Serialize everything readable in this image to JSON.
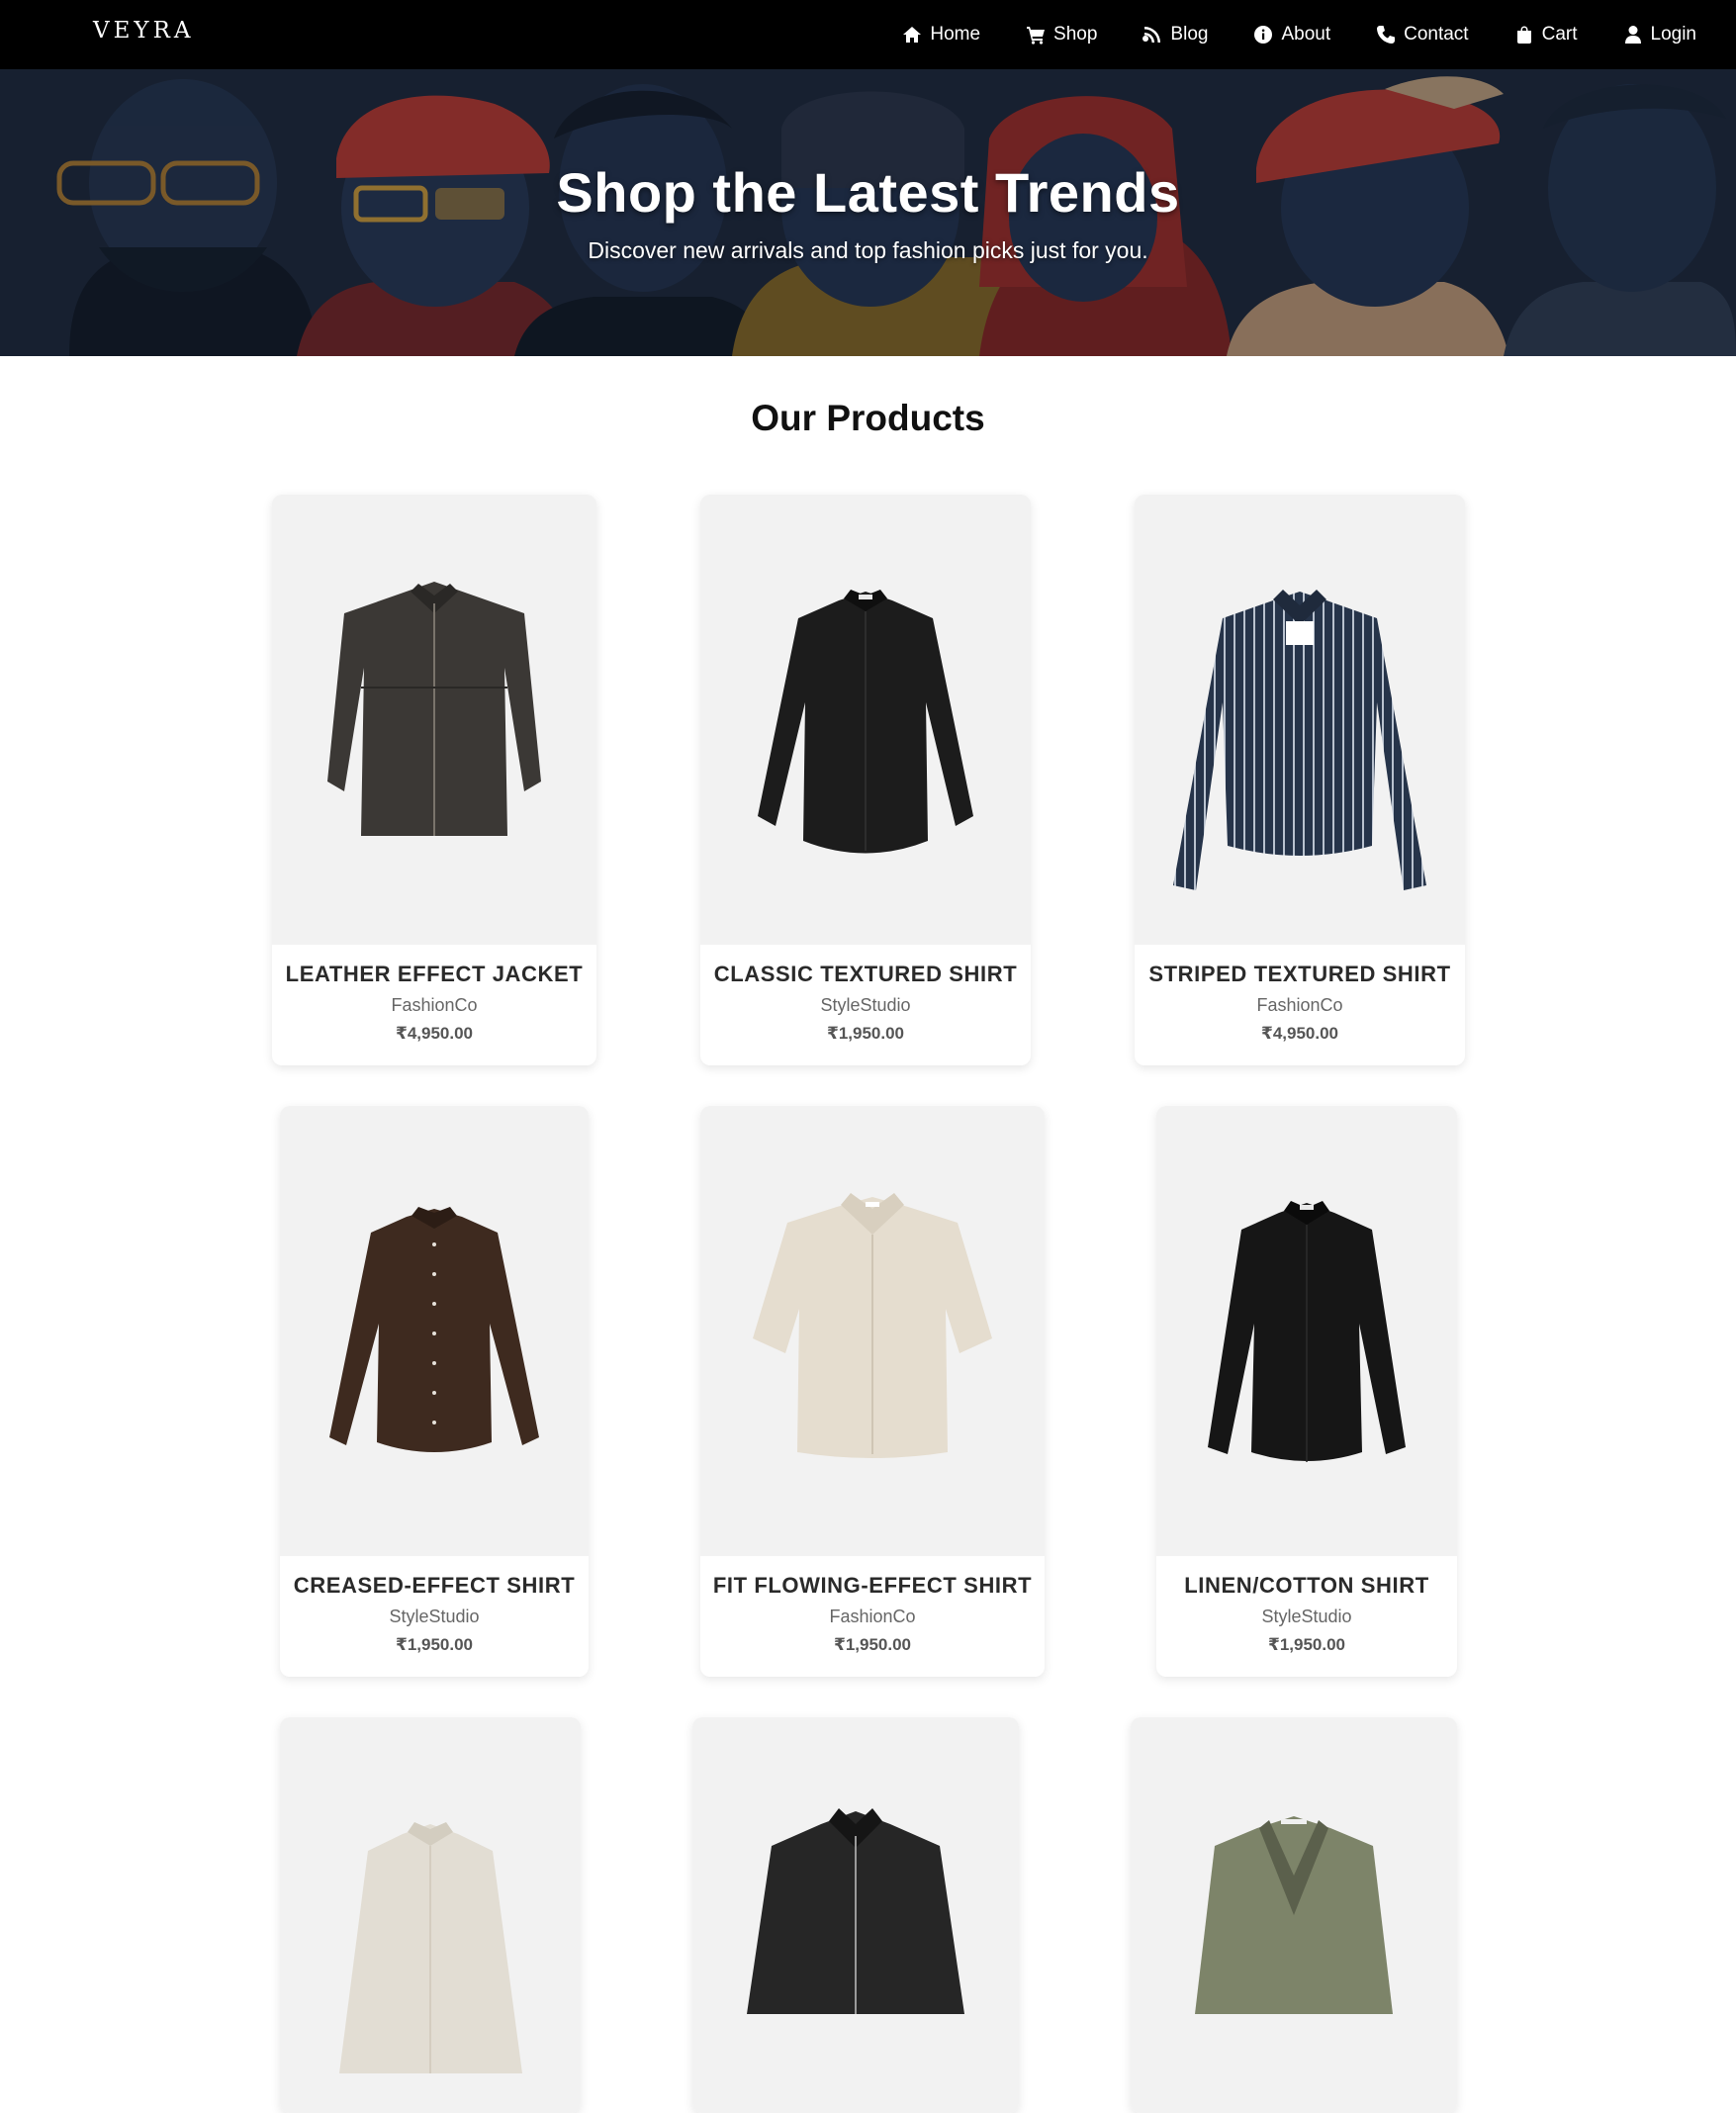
{
  "brand": {
    "logo": "VEYRA"
  },
  "nav": {
    "items": [
      {
        "label": "Home",
        "icon": "home-icon"
      },
      {
        "label": "Shop",
        "icon": "cart-icon"
      },
      {
        "label": "Blog",
        "icon": "blog-icon"
      },
      {
        "label": "About",
        "icon": "info-icon"
      },
      {
        "label": "Contact",
        "icon": "phone-icon"
      },
      {
        "label": "Cart",
        "icon": "bag-icon"
      },
      {
        "label": "Login",
        "icon": "user-icon"
      }
    ]
  },
  "hero": {
    "title": "Shop the Latest Trends",
    "subtitle": "Discover new arrivals and top fashion picks just for you."
  },
  "products_section": {
    "title": "Our Products",
    "items": [
      {
        "name": "LEATHER EFFECT JACKET",
        "brand": "FashionCo",
        "price": "₹4,950.00",
        "color": "#3b3835"
      },
      {
        "name": "CLASSIC TEXTURED SHIRT",
        "brand": "StyleStudio",
        "price": "₹1,950.00",
        "color": "#1c1c1c"
      },
      {
        "name": "STRIPED TEXTURED SHIRT",
        "brand": "FashionCo",
        "price": "₹4,950.00",
        "color": "#26344a"
      },
      {
        "name": "CREASED-EFFECT SHIRT",
        "brand": "StyleStudio",
        "price": "₹1,950.00",
        "color": "#3e2a1f"
      },
      {
        "name": "FIT FLOWING-EFFECT SHIRT",
        "brand": "FashionCo",
        "price": "₹1,950.00",
        "color": "#e5ddcf"
      },
      {
        "name": "LINEN/COTTON SHIRT",
        "brand": "StyleStudio",
        "price": "₹1,950.00",
        "color": "#161616"
      },
      {
        "name": "",
        "brand": "",
        "price": "",
        "color": "#e2ddd3"
      },
      {
        "name": "",
        "brand": "",
        "price": "",
        "color": "#262626"
      },
      {
        "name": "",
        "brand": "",
        "price": "",
        "color": "#7d8469"
      }
    ]
  }
}
